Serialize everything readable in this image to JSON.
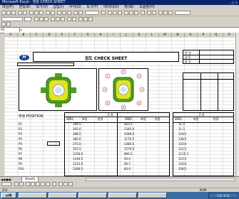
{
  "window": {
    "title": "Microsoft Excel - 점검 CHECK SHEET"
  },
  "menu": {
    "items": [
      "파일(F)",
      "편집(E)",
      "보기(V)",
      "삽입(I)",
      "서식(O)",
      "도구(T)",
      "데이터(D)",
      "창(W)",
      "도움말(H)"
    ]
  },
  "formula": {
    "cell_ref": "A1",
    "value": ""
  },
  "sheet": {
    "title": "검도 CHECK SHEET",
    "approval_labels": [
      "작 성",
      "검 토",
      "승 인"
    ],
    "spec_title": "측정 POSITION",
    "section_headers": [
      "1 차",
      "2 차"
    ],
    "table_headers": [
      "SPEC",
      "측정",
      "판정"
    ],
    "positions": [
      "P1",
      "P2",
      "P3",
      "P4",
      "P5",
      "P6",
      "P7",
      "P8",
      "P9",
      "P10"
    ],
    "spec_values_left": [
      "189.5",
      "205.0",
      "288.5",
      "380.0",
      "375.0",
      "355.5",
      "1256.0",
      "1140.5",
      "1215.0",
      "1280.5"
    ],
    "spec_values_mid": [
      "420.5",
      "2345.0",
      "4280.0",
      "1170.5",
      "2385.5",
      "1570.0",
      "895.0",
      "45.0",
      "60.5",
      "83.0"
    ],
    "spec_values_right": [
      "11.5",
      "11.5",
      "118.5",
      "138.5",
      "110.0",
      "121.5",
      "1115.5",
      "115.5",
      "118.0",
      "158.5"
    ],
    "diagram_markers": [
      "1",
      "2",
      "3",
      "4",
      "5",
      "6",
      "7",
      "8"
    ]
  },
  "tabs": {
    "active": "Sheet1"
  },
  "status": {
    "text": "준비",
    "mode": "NUM"
  },
  "taskbar": {
    "start": "시작",
    "clock": "오후 3:15"
  },
  "colors": {
    "title_bg": "#0a246a",
    "taskbar": "#3a6ea5",
    "part_green": "#4fa01e",
    "part_yellow": "#e8e020"
  }
}
